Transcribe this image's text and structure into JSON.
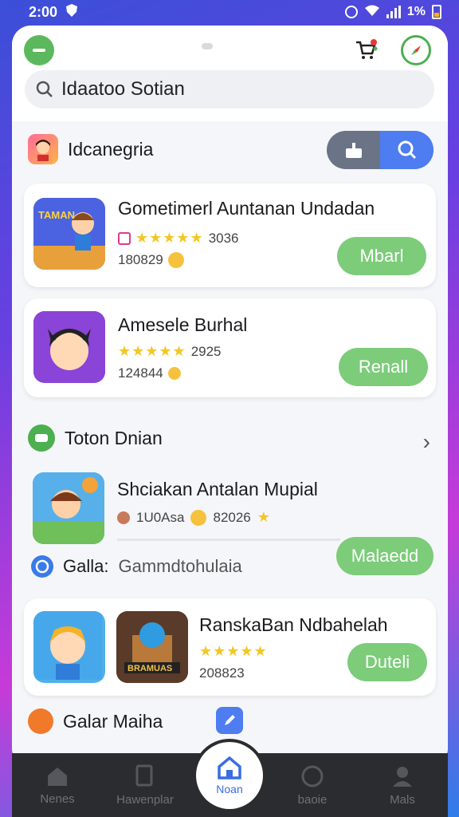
{
  "status": {
    "time": "2:00",
    "battery": "1%"
  },
  "search": {
    "query": "Idaatoo Sotian"
  },
  "section1": {
    "title": "Idcanegria"
  },
  "cards": [
    {
      "name": "Gometimerl Auntanan Undadan",
      "rating_code": "3036",
      "count": "180829",
      "action": "Mbarl",
      "thumb_text": "TAMAN"
    },
    {
      "name": "Amesele Burhal",
      "rating_code": "2925",
      "count": "124844",
      "action": "Renall"
    }
  ],
  "section2": {
    "title": "Toton Dnian"
  },
  "card3": {
    "name": "Shciakan Antalan Mupial",
    "meta1": "1U0Asa",
    "meta2": "82026",
    "action": "Malaedd"
  },
  "galla": {
    "label": "Galla:",
    "value": "Gammdtohulaia"
  },
  "card4": {
    "name": "RanskaBan Ndbahelah",
    "count": "208823",
    "action": "Duteli",
    "thumb_text": "BRAMUAS"
  },
  "section3": {
    "title": "Galar Maiha"
  },
  "nav": [
    {
      "label": "Nenes",
      "icon": "home-outline-icon"
    },
    {
      "label": "Hawenplar",
      "icon": "tablet-icon"
    },
    {
      "label": "Noan",
      "icon": "home-icon"
    },
    {
      "label": "baoie",
      "icon": "coin-icon"
    },
    {
      "label": "Mals",
      "icon": "profile-icon"
    }
  ],
  "colors": {
    "accent_green": "#7ccc7a",
    "accent_blue": "#4d7df0",
    "nav_bg": "#2b2c30"
  }
}
